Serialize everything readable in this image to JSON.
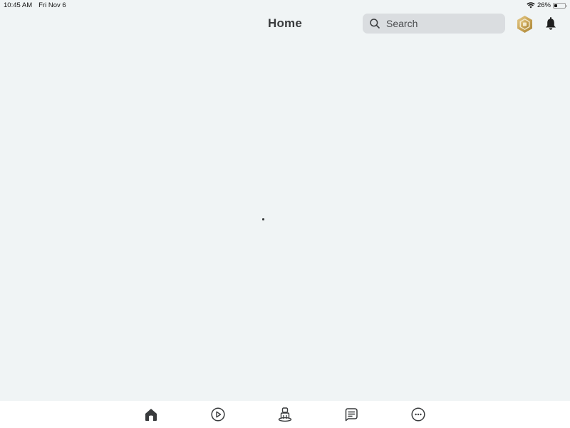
{
  "status_bar": {
    "time": "10:45 AM",
    "date": "Fri Nov 6",
    "wifi_icon": "wifi-icon",
    "battery_percent": "26%",
    "battery_level": 0.26
  },
  "header": {
    "title": "Home",
    "search": {
      "placeholder": "Search",
      "icon": "search-icon"
    },
    "robux_icon": "robux-icon",
    "notifications_icon": "bell-icon"
  },
  "main": {
    "loading": true
  },
  "bottom_nav": {
    "items": [
      {
        "name": "home",
        "icon": "home-icon",
        "active": true
      },
      {
        "name": "discover",
        "icon": "play-icon",
        "active": false
      },
      {
        "name": "avatar",
        "icon": "avatar-icon",
        "active": false
      },
      {
        "name": "chat",
        "icon": "chat-icon",
        "active": false
      },
      {
        "name": "more",
        "icon": "more-icon",
        "active": false
      }
    ]
  },
  "colors": {
    "background": "#F0F4F5",
    "text": "#393B3D",
    "search_bg": "#DADDE0",
    "robux_gold": "#C9A456",
    "nav_bg": "#FFFFFF"
  }
}
